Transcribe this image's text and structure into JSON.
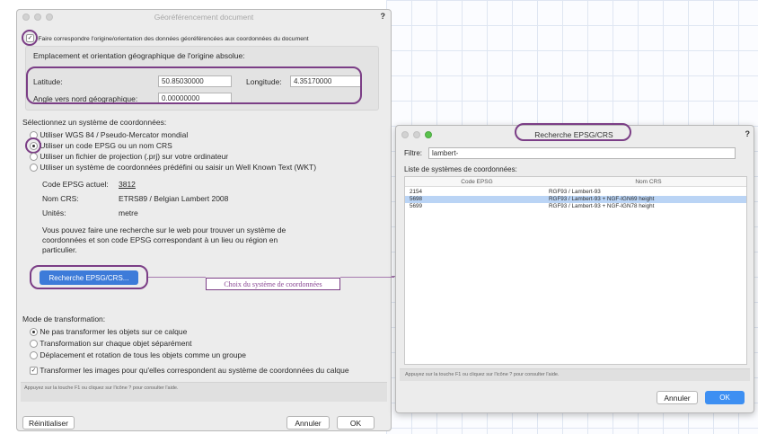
{
  "dialog1": {
    "title": "Géoréférencement document",
    "help_mark": "?",
    "match_checkbox_label": "Faire correspondre l'origine/orientation des données géoréférencées aux coordonnées du document",
    "origin_section_title": "Emplacement et orientation géographique de l'origine absolue:",
    "latitude_label": "Latitude:",
    "latitude_value": "50.85030000",
    "longitude_label": "Longitude:",
    "longitude_value": "4.35170000",
    "angle_label": "Angle vers nord géographique:",
    "angle_value": "0.00000000",
    "coord_system_title": "Sélectionnez un système de coordonnées:",
    "radio_options": [
      "Utiliser WGS 84 / Pseudo-Mercator mondial",
      "Utiliser un code EPSG ou un nom CRS",
      "Utiliser un fichier de projection (.prj) sur votre ordinateur",
      "Utiliser un système de coordonnées prédéfini ou saisir un Well Known Text (WKT)"
    ],
    "epsg_current_label": "Code EPSG actuel:",
    "epsg_current_value": "3812",
    "crs_name_label": "Nom CRS:",
    "crs_name_value": "ETRS89 / Belgian Lambert 2008",
    "units_label": "Unités:",
    "units_value": "metre",
    "web_search_text_1": "Vous pouvez faire une recherche sur le web pour trouver un système de",
    "web_search_text_2": "coordonnées et son code EPSG correspondant à un lieu ou région en",
    "web_search_text_3": "particulier.",
    "search_button": "Recherche EPSG/CRS...",
    "callout_text": "Choix du système de coordonnées",
    "transform_title": "Mode de transformation:",
    "transform_options": [
      "Ne pas transformer les objets sur ce calque",
      "Transformation sur chaque objet séparément",
      "Déplacement et rotation de tous les objets comme un groupe"
    ],
    "transform_images_label": "Transformer les images pour qu'elles correspondent au système de coordonnées du calque",
    "hint": "Appuyez sur la touche F1 ou cliquez sur l'icône ? pour consulter l'aide.",
    "reset_button": "Réinitialiser",
    "cancel_button": "Annuler",
    "ok_button": "OK"
  },
  "dialog2": {
    "title": "Recherche EPSG/CRS",
    "help_mark": "?",
    "filter_label": "Filtre:",
    "filter_value": "lambert-",
    "list_title": "Liste de systèmes de coordonnées:",
    "columns": [
      "Code EPSG",
      "Nom CRS"
    ],
    "rows": [
      {
        "code": "2154",
        "name": "RGF93 / Lambert-93"
      },
      {
        "code": "5698",
        "name": "RGF93 / Lambert-93 + NGF-IGN69 height"
      },
      {
        "code": "5699",
        "name": "RGF93 / Lambert-93 + NGF-IGN78 height"
      }
    ],
    "selected_row": 1,
    "hint": "Appuyez sur la touche F1 ou cliquez sur l'icône ? pour consulter l'aide.",
    "cancel_button": "Annuler",
    "ok_button": "OK"
  },
  "colors": {
    "annotation_purple": "#7b3e86",
    "primary_button_blue": "#3d7bd9",
    "selected_row_blue": "#bad4f5"
  }
}
